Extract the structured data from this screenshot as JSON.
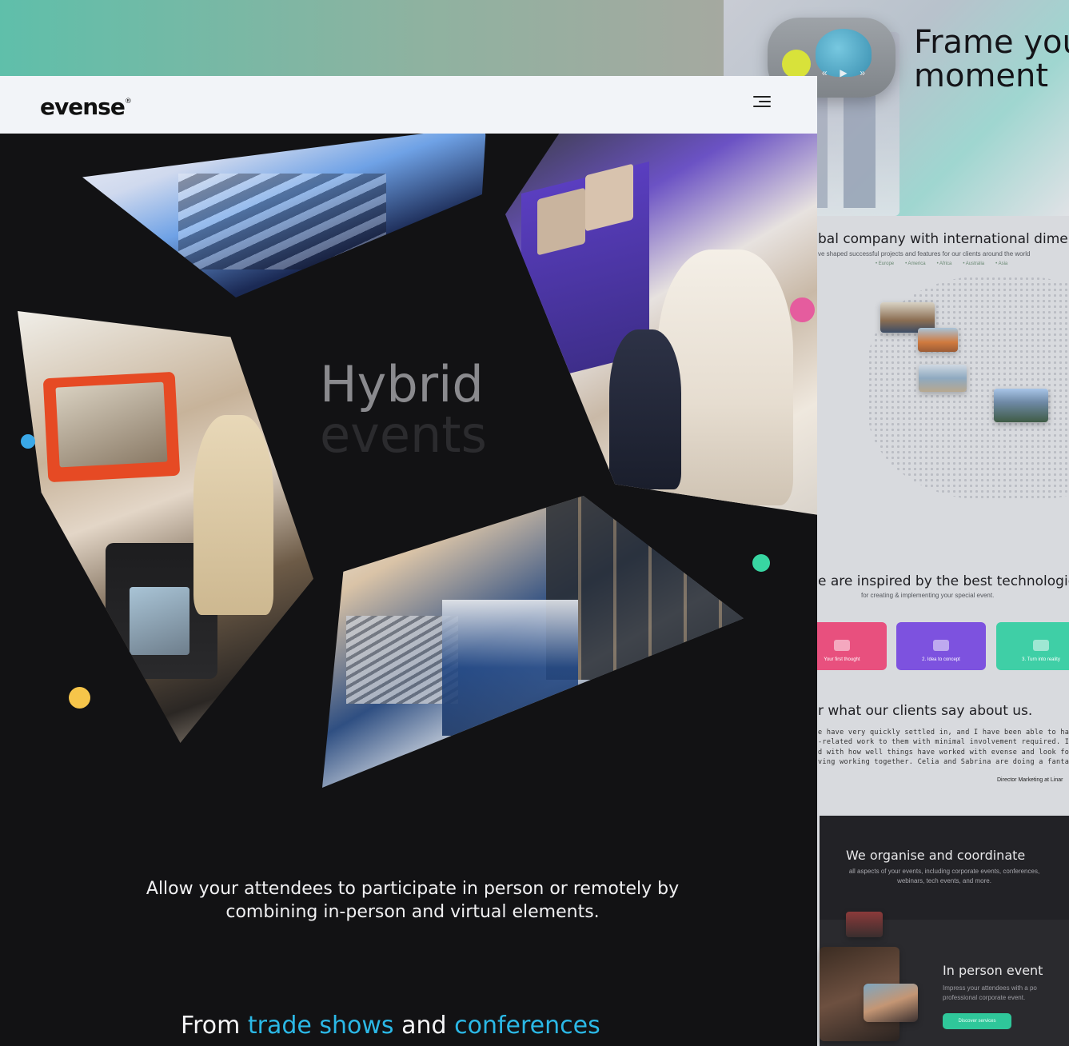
{
  "header": {
    "logo_text": "evense",
    "logo_mark": "®",
    "menu_icon": "hamburger-menu-icon"
  },
  "main": {
    "hero_line1": "Hybrid",
    "hero_line2": "events",
    "intro": "Allow your attendees to participate in person or remotely by combining in-person and virtual elements.",
    "from_prefix": "From",
    "from_hl1": "trade shows",
    "from_mid": "and",
    "from_hl2": "conferences"
  },
  "preview": {
    "hero_title_line1": "Frame you",
    "hero_title_line2": "moment",
    "global_title": "bal company with international dimen",
    "global_sub": "ve shaped successful projects and features for our clients around the world",
    "regions": [
      "• Europe",
      "• America",
      "• Africa",
      "• Australia",
      "• Asia"
    ],
    "tech_title": "e are inspired by the best technologie",
    "tech_sub": "for creating & implementing your special event.",
    "steps": [
      {
        "label": "Your first thought",
        "color": "#e8507e"
      },
      {
        "label": "2. Idea to concept",
        "color": "#7d52df"
      },
      {
        "label": "3. Turn into reality",
        "color": "#3fcfa6"
      }
    ],
    "clients_title": "r what our clients say about us.",
    "quote": "e have very quickly settled in, and I have been able to hand ove\n-related work to them with minimal involvement required. I'm r\nd with how well things have worked with evense and look forwar\nving working together. Celia and Sabrina are doing a fantastic job.\"",
    "quote_author": "Director Marketing at Linar",
    "organise_title": "We organise and coordinate",
    "organise_sub": "all aspects of your events, including corporate events, conferences, webinars, tech events, and more.",
    "inperson_title": "In person event",
    "inperson_sub_line1": "Impress your attendees with a po",
    "inperson_sub_line2": "professional corporate event.",
    "inperson_button": "Discover services"
  },
  "colors": {
    "accent_blue": "#2bb8e6",
    "dot_pink": "#e55c9e",
    "dot_blue": "#3aa8e8",
    "dot_yellow": "#f6c54a",
    "dot_green": "#38d6a2"
  }
}
